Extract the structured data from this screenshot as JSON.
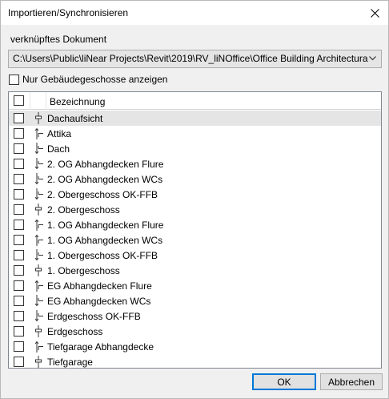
{
  "window": {
    "title": "Importieren/Synchronisieren",
    "close_icon": "close-icon"
  },
  "document": {
    "label": "verknüpftes Dokument",
    "path": "C:\\Users\\Public\\liNear Projects\\Revit\\2019\\RV_liNOffice\\Office Building Architectura"
  },
  "filter": {
    "only_floors_label": "Nur Gebäudegeschosse anzeigen",
    "only_floors_checked": false
  },
  "grid": {
    "header": "Bezeichnung",
    "rows": [
      {
        "name": "Dachaufsicht",
        "type": "floor",
        "selected": true
      },
      {
        "name": "Attika",
        "type": "above"
      },
      {
        "name": "Dach",
        "type": "below"
      },
      {
        "name": "2. OG Abhangdecken Flure",
        "type": "below"
      },
      {
        "name": "2. OG Abhangdecken WCs",
        "type": "below"
      },
      {
        "name": "2. Obergeschoss OK-FFB",
        "type": "below"
      },
      {
        "name": "2. Obergeschoss",
        "type": "floor"
      },
      {
        "name": "1. OG Abhangdecken Flure",
        "type": "above"
      },
      {
        "name": "1. OG Abhangdecken WCs",
        "type": "above"
      },
      {
        "name": "1. Obergeschoss OK-FFB",
        "type": "below"
      },
      {
        "name": "1. Obergeschoss",
        "type": "floor"
      },
      {
        "name": "EG Abhangdecken Flure",
        "type": "above"
      },
      {
        "name": "EG Abhangdecken WCs",
        "type": "below"
      },
      {
        "name": "Erdgeschoss OK-FFB",
        "type": "below"
      },
      {
        "name": "Erdgeschoss",
        "type": "floor"
      },
      {
        "name": "Tiefgarage Abhangdecke",
        "type": "above"
      },
      {
        "name": "Tiefgarage",
        "type": "floor"
      }
    ]
  },
  "buttons": {
    "ok": "OK",
    "cancel": "Abbrechen"
  }
}
